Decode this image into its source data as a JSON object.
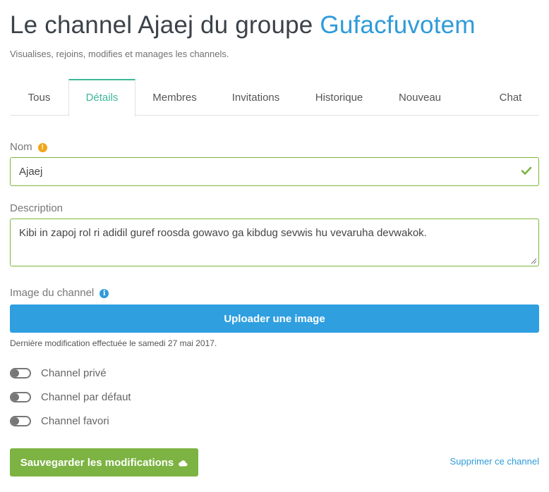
{
  "header": {
    "title_prefix": "Le channel Ajaej du groupe",
    "group_name": "Gufacfuvotem",
    "subtitle": "Visualises, rejoins, modifies et manages les channels."
  },
  "tabs": [
    {
      "label": "Tous",
      "active": false
    },
    {
      "label": "Détails",
      "active": true
    },
    {
      "label": "Membres",
      "active": false
    },
    {
      "label": "Invitations",
      "active": false
    },
    {
      "label": "Historique",
      "active": false
    },
    {
      "label": "Nouveau",
      "active": false
    },
    {
      "label": "Chat",
      "active": false
    }
  ],
  "form": {
    "name_label": "Nom",
    "name_value": "Ajaej",
    "description_label": "Description",
    "description_value": "Kibi in zapoj rol ri adidil guref roosda gowavo ga kibdug sevwis hu vevaruha devwakok.",
    "image_label": "Image du channel",
    "upload_button": "Uploader une image",
    "last_modified": "Dernière modification effectuée le samedi 27 mai 2017.",
    "toggles": [
      {
        "label": "Channel privé",
        "on": false
      },
      {
        "label": "Channel par défaut",
        "on": false
      },
      {
        "label": "Channel favori",
        "on": false
      }
    ],
    "save_button": "Sauvegarder les modifications",
    "delete_link": "Supprimer ce channel"
  },
  "colors": {
    "title": "#3b4249",
    "group_name": "#2e9bd9",
    "active_tab": "#3fb79a",
    "valid_border": "#7db83b",
    "upload_button": "#2f9fe0",
    "save_button": "#7cb342",
    "warning_icon": "#f2a51a",
    "info_icon": "#2e9bd9",
    "link": "#2e9bd9"
  },
  "icons": {
    "name_warning": "exclamation-circle",
    "name_valid": "checkmark",
    "image_info": "info-circle",
    "save": "cloud"
  }
}
